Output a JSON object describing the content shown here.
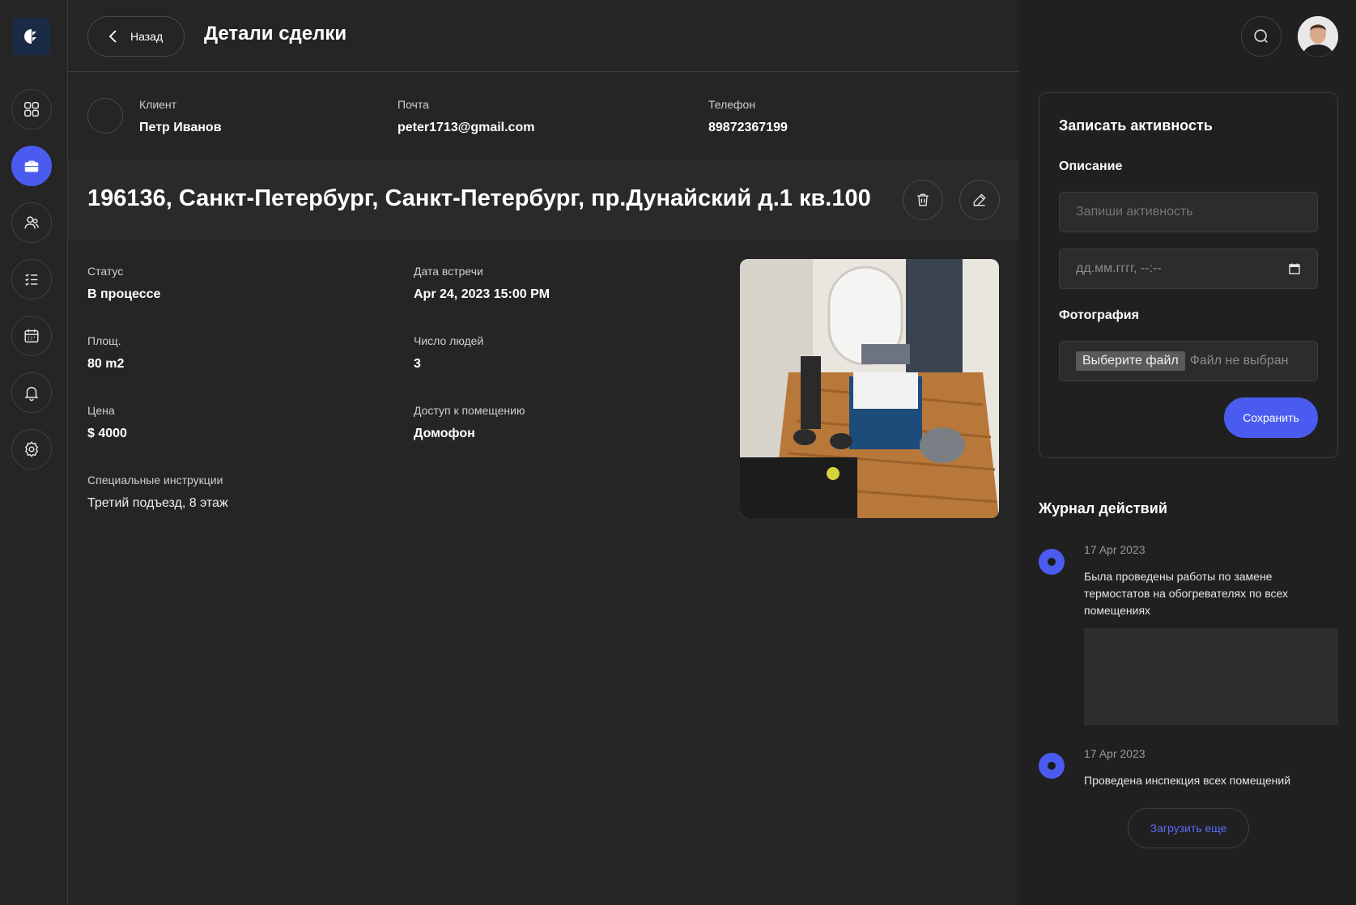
{
  "header": {
    "back_label": "Назад",
    "title": "Детали сделки"
  },
  "sidebar": {
    "items": [
      {
        "icon": "dashboard-icon"
      },
      {
        "icon": "briefcase-icon",
        "active": true
      },
      {
        "icon": "users-icon"
      },
      {
        "icon": "checklist-icon"
      },
      {
        "icon": "calendar-icon"
      },
      {
        "icon": "bell-icon"
      },
      {
        "icon": "gear-icon"
      }
    ]
  },
  "client": {
    "client_label": "Клиент",
    "client_name": "Петр Иванов",
    "email_label": "Почта",
    "email": "peter1713@gmail.com",
    "phone_label": "Телефон",
    "phone": "89872367199"
  },
  "deal": {
    "address": "196136, Санкт-Петербург, Санкт-Петербург, пр.Дунайский д.1 кв.100",
    "status_label": "Статус",
    "status": "В процессе",
    "meeting_label": "Дата встречи",
    "meeting": "Apr 24, 2023 15:00 PM",
    "area_label": "Площ.",
    "area": "80 m2",
    "people_label": "Число людей",
    "people": "3",
    "price_label": "Цена",
    "price": "$ 4000",
    "access_label": "Доступ к помещению",
    "access": "Домофон",
    "instructions_label": "Специальные инструкции",
    "instructions": "Третий подъезд, 8 этаж"
  },
  "activity_form": {
    "title": "Записать активность",
    "description_label": "Описание",
    "description_placeholder": "Запиши активность",
    "date_placeholder": "дд.мм.гггг, --:--",
    "photo_label": "Фотография",
    "file_button": "Выберите файл",
    "file_status": "Файл не выбран",
    "save_label": "Сохранить"
  },
  "journal": {
    "title": "Журнал действий",
    "entries": [
      {
        "date": "17 Apr 2023",
        "text": "Была проведены работы по замене термостатов на обогревателях по всех помещениях"
      },
      {
        "date": "17 Apr 2023",
        "text": "Проведена инспекция всех помещений"
      }
    ],
    "load_more_label": "Загрузить еще"
  },
  "colors": {
    "accent": "#4a5cf0",
    "background": "#252525",
    "panel": "#202020"
  }
}
